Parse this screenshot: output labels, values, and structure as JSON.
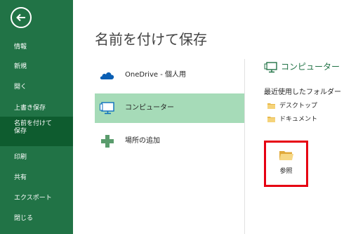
{
  "nav": {
    "items": [
      {
        "label": "情報"
      },
      {
        "label": "新規"
      },
      {
        "label": "開く"
      },
      {
        "label": "上書き保存"
      },
      {
        "label_line1": "名前を付けて",
        "label_line2": "保存"
      },
      {
        "label": "印刷"
      },
      {
        "label": "共有"
      },
      {
        "label": "エクスポート"
      },
      {
        "label": "閉じる"
      }
    ]
  },
  "page_title": "名前を付けて保存",
  "locations": [
    {
      "label": "OneDrive - 個人用",
      "icon": "cloud-icon"
    },
    {
      "label": "コンピューター",
      "icon": "computer-icon",
      "selected": true
    },
    {
      "label": "場所の追加",
      "icon": "plus-icon"
    }
  ],
  "panel": {
    "title": "コンピューター",
    "recent_heading": "最近使用したフォルダー",
    "recent_folders": [
      "デスクトップ",
      "ドキュメント"
    ],
    "browse_label": "参照"
  },
  "colors": {
    "nav_background": "#217346",
    "selected_location": "#a6dbb8",
    "highlight_border": "#e60012"
  }
}
